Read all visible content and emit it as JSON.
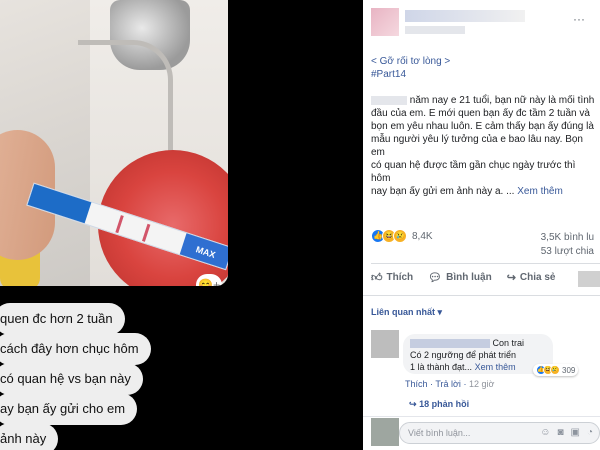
{
  "photo": {
    "strip_label": "MAX",
    "corner_icon": "😊+"
  },
  "chat": [
    {
      "text": "quen đc hơn 2 tuần"
    },
    {
      "text": "cách đây hơn chục hôm"
    },
    {
      "text": "có quan hệ vs bạn này"
    },
    {
      "text": "ay bạn ấy gửi cho em"
    },
    {
      "text": "ảnh này"
    }
  ],
  "post": {
    "more_icon": "···",
    "lines": {
      "l1": "< Gỡ rối tơ lòng >",
      "l2": "#Part14",
      "l3": "năm nay e 21 tuổi, bạn nữ này là mối tình",
      "l4": "đầu của em. E mới quen bạn ấy đc tầm 2 tuần và",
      "l5": "bọn em yêu nhau luôn. E cảm thấy bạn ấy đúng là",
      "l6": "mẫu người yêu lý tưởng của e bao lâu nay. Bọn em",
      "l7": "có quan hệ được tầm gần chục ngày trước thì hôm",
      "l8": "nay bạn ấy gửi em ảnh này a. ...",
      "see_more": "Xem thêm"
    },
    "reaction_count": "8,4K",
    "comments": "3,5K bình lu",
    "shares": "53 lượt chia",
    "like": "Thích",
    "comment": "Bình luận",
    "share": "Chia sẻ",
    "related": "Liên quan nhất ▾"
  },
  "comment": {
    "text1": "Con trai",
    "text2": "Có 2 ngưỡng để phát triển",
    "text3": "1 là thành đạt...",
    "see_more": "Xem thêm",
    "react_count": "309",
    "like": "Thích",
    "reply": "Trả lời",
    "time": "12 giờ",
    "replies": "18 phản hồi"
  },
  "write": {
    "placeholder": "Viết bình luận..."
  },
  "colors": {
    "fb_blue": "#385898",
    "like_blue": "#1877f2"
  }
}
